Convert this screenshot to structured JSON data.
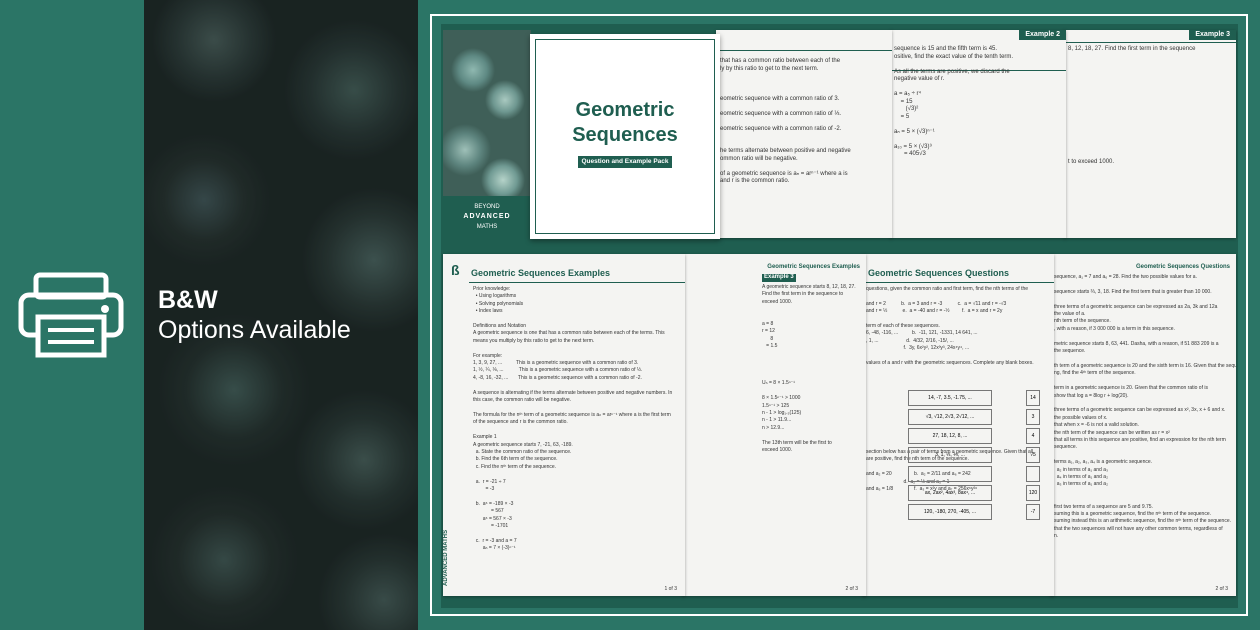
{
  "left": {
    "printer_icon": "printer-icon",
    "heading": "B&W",
    "subheading": "Options Available"
  },
  "cover": {
    "title_line1": "Geometric",
    "title_line2": "Sequences",
    "badge": "Question and Example Pack",
    "brand_top": "BEYOND",
    "brand_main": "ADVANCED",
    "brand_bottom": "MATHS"
  },
  "top_sheets": {
    "page1_text": "that has a common ratio between each of the\nly by this ratio to get to the next term.\n\n\n\neometric sequence with a common ratio of 3.\n\neometric sequence with a common ratio of ⅓.\n\neometric sequence with a common ratio of -2.\n\n\nhe terms alternate between positive and negative\nommon ratio will be negative.\n\nof a geometric sequence is aₙ = arⁿ⁻¹ where a is\nand r is the common ratio.",
    "page2_label": "Example 2",
    "page2_text": "sequence is 15 and the fifth term is 45.\nositive, find the exact value of the tenth term.\n\nAs all the terms are positive, we discard the\nnegative value of r.\n\na = a₅ ÷ r⁴\n    = 15\n       (√3)²\n    = 5\n\naₙ = 5 × (√3)ⁿ⁻¹\n\na₁₀ = 5 × (√3)⁹\n      = 405√3",
    "page3_label": "Example 3",
    "page3_text": "8, 12, 18, 27. Find the first term in the sequence\n\n\n\n\n\n\n\n\n\n\n\n\n\n\nt to exceed 1000."
  },
  "bottom_sheets": {
    "examples_title": "Geometric Sequences Examples",
    "examples_text": "Prior knowledge:\n  • Using logarithms\n  • Solving polynomials\n  • Index laws\n\nDefinitions and Notation\nA geometric sequence is one that has a common ratio between each of the terms. This\nmeans you multiply by this ratio to get to the next term.\n\nFor example:\n1, 3, 9, 27, ...          This is a geometric sequence with a common ratio of 3.\n1, ½, ¼, ⅛, ...           This is a geometric sequence with a common ratio of ½.\n4, -8, 16, -32, ...       This is a geometric sequence with a common ratio of -2.\n\nA sequence is alternating if the terms alternate between positive and negative numbers. In\nthis case, the common ratio will be negative.\n\nThe formula for the nᵗʰ term of a geometric sequence is aₙ = arⁿ⁻¹ where a is the first term\nof the sequence and r is the common ratio.\n\nExample 1\nA geometric sequence starts 7, -21, 63, -189.\n  a. State the common ratio of the sequence.\n  b. Find the 6th term of the sequence.\n  c. Find the nᵗʰ term of the sequence.\n\n  a.  r = -21 ÷ 7\n         = -3\n\n  b.  a⁶ = -189 × -3\n             = 567\n       a⁶ = 567 × -3\n             = -1701\n\n  c.  r = -3 and a = 7\n       aₙ = 7 × (-3)ⁿ⁻¹",
    "examples_pageno": "1 of 3",
    "examples2_header": "Geometric Sequences Examples",
    "examples2_text": "A geometric sequence starts 8, 12, 18, 27.\nFind the first term in the sequence to\nexceed 1000.\n\n\na = 8\nr = 12\n      8\n   = 1.5\n\n\n\n\nUₙ = 8 × 1.5ⁿ⁻¹\n\n8 × 1.5ⁿ⁻¹ > 1000\n1.5ⁿ⁻¹ > 125\nn - 1 > log₁.₅(125)\nn - 1 > 11.9...\nn > 12.9...\n\nThe 13th term will be the first to\nexceed 1000.",
    "examples2_pageno": "2 of 3",
    "examples2_label": "Example 3",
    "questions_title": "Geometric Sequences Questions",
    "questions_text": "questions, given the common ratio and first term, find the nth terms of the\n\nand r = 2           b.  a = 3 and r = -3           c.  a = √11 and r = -√3\nand r = ½           e.  a = -40 and r = -½         f.  a = x and r = 2y\n\nterm of each of these sequences.\n6, -48, -116, ...          b.  -11, 121, -1331, 14 641, ...\n, 1, ...                    d.  4/32, 2/16, -15/, ...\n                           f.  3y, 6x²y², 12x³y³, 24x⁴y⁴, ...\n\nvalues of a and r with the geometric sequences. Complete any blank boxes.\n\n\n\n\n\n\n\n\n\n\n\nsection below has a pair of terms from a geometric sequence. Given that all\nare positive, find the nth term of the sequence.\n\nand a₂ = 20                b.  a₂ = 2/11 and a₆ = 242\n                           d.  a₂ = ½ and a₅ = 1\nand a₅ = 1/8               f.  a₃ = x²y and a₇ = 256x⁶y²⁶",
    "questions_boxes": [
      "14, -7, 3.5, -1.75, ...",
      "√3, √12, 2√3, 2√12, ...",
      "27, 18, 12, 8, ...",
      "3, 1, ⅓, ⅑, ...",
      "",
      "ax, 2ax², 4ax³, 8ax⁴, ...",
      "120, -180, 270, -405, ..."
    ],
    "questions_values": [
      "14",
      "3",
      "4",
      "√5",
      "",
      "120",
      "-7"
    ],
    "questions2_header": "Geometric Sequences Questions",
    "questions2_text": "sequence, a₁ = 7 and a₆ = 28. Find the two possible values for a.\n\nsequence starts ⅔, 3, 18. Find the first term that is greater than 10 000.\n\nthree terms of a geometric sequence can be expressed as 2a, 3k and 12a\nthe value of a.\nnth term of the sequence.\n, with a reason, if 3 000 000 is a term in this sequence.\n\nmetric sequence starts 8, 63, 441. Dasha, with a reason, if 51 883 209 is a\nthe sequence.\n\nth term of a geometric sequence is 20 and the sixth term is 16. Given that the sequence\nng, find the 4ᵗʰ term of the sequence.\n\nterm in a geometric sequence is 20. Given that the common ratio of is\nshow that log a = 8log r + log(20).\n\nthree terms of a geometric sequence can be expressed as x², 3x, x + 6 and x.\nthe possible values of x.\nthat when x = -6 is not a valid solution.\nthe nth term of the sequence can be written as r = x²\nthat all terms in this sequence are positive, find an expression for the nth term\nsequence.\n\nterms a₁, a₂, a₃, a₄ is a geometric sequence.\n  a₂ in terms of a₁ and a₃\n  a₄ in terms of a₁ and a₂\n  a₃ in terms of a₁ and a₂\n\n\nfirst two terms of a sequence are 5 and 9.75.\nsuming this is a geometric sequence, find the nᵗʰ term of the sequence.\nsuming instead this is an arithmetic sequence, find the nᵗʰ term of the sequence.\nthat the two sequences will not have any other common terms, regardless of\nn.",
    "questions2_pageno": "2 of 3",
    "brand_vertical": "ADVANCED MATHS"
  }
}
